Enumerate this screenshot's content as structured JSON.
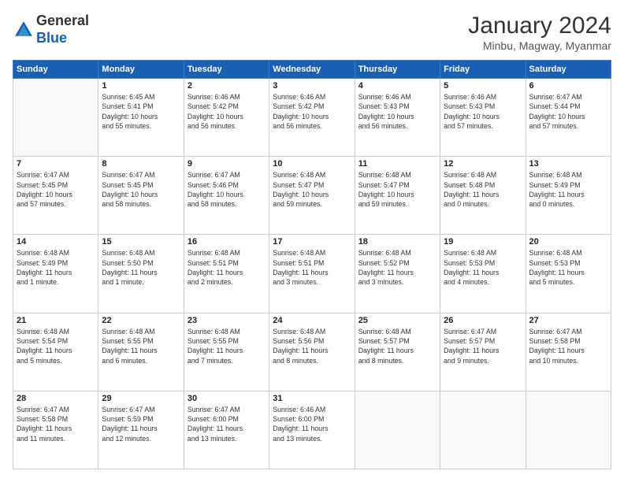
{
  "logo": {
    "line1": "General",
    "line2": "Blue"
  },
  "title": "January 2024",
  "location": "Minbu, Magway, Myanmar",
  "days_header": [
    "Sunday",
    "Monday",
    "Tuesday",
    "Wednesday",
    "Thursday",
    "Friday",
    "Saturday"
  ],
  "weeks": [
    [
      {
        "day": "",
        "info": ""
      },
      {
        "day": "1",
        "info": "Sunrise: 6:45 AM\nSunset: 5:41 PM\nDaylight: 10 hours\nand 55 minutes."
      },
      {
        "day": "2",
        "info": "Sunrise: 6:46 AM\nSunset: 5:42 PM\nDaylight: 10 hours\nand 56 minutes."
      },
      {
        "day": "3",
        "info": "Sunrise: 6:46 AM\nSunset: 5:42 PM\nDaylight: 10 hours\nand 56 minutes."
      },
      {
        "day": "4",
        "info": "Sunrise: 6:46 AM\nSunset: 5:43 PM\nDaylight: 10 hours\nand 56 minutes."
      },
      {
        "day": "5",
        "info": "Sunrise: 6:46 AM\nSunset: 5:43 PM\nDaylight: 10 hours\nand 57 minutes."
      },
      {
        "day": "6",
        "info": "Sunrise: 6:47 AM\nSunset: 5:44 PM\nDaylight: 10 hours\nand 57 minutes."
      }
    ],
    [
      {
        "day": "7",
        "info": "Sunrise: 6:47 AM\nSunset: 5:45 PM\nDaylight: 10 hours\nand 57 minutes."
      },
      {
        "day": "8",
        "info": "Sunrise: 6:47 AM\nSunset: 5:45 PM\nDaylight: 10 hours\nand 58 minutes."
      },
      {
        "day": "9",
        "info": "Sunrise: 6:47 AM\nSunset: 5:46 PM\nDaylight: 10 hours\nand 58 minutes."
      },
      {
        "day": "10",
        "info": "Sunrise: 6:48 AM\nSunset: 5:47 PM\nDaylight: 10 hours\nand 59 minutes."
      },
      {
        "day": "11",
        "info": "Sunrise: 6:48 AM\nSunset: 5:47 PM\nDaylight: 10 hours\nand 59 minutes."
      },
      {
        "day": "12",
        "info": "Sunrise: 6:48 AM\nSunset: 5:48 PM\nDaylight: 11 hours\nand 0 minutes."
      },
      {
        "day": "13",
        "info": "Sunrise: 6:48 AM\nSunset: 5:49 PM\nDaylight: 11 hours\nand 0 minutes."
      }
    ],
    [
      {
        "day": "14",
        "info": "Sunrise: 6:48 AM\nSunset: 5:49 PM\nDaylight: 11 hours\nand 1 minute."
      },
      {
        "day": "15",
        "info": "Sunrise: 6:48 AM\nSunset: 5:50 PM\nDaylight: 11 hours\nand 1 minute."
      },
      {
        "day": "16",
        "info": "Sunrise: 6:48 AM\nSunset: 5:51 PM\nDaylight: 11 hours\nand 2 minutes."
      },
      {
        "day": "17",
        "info": "Sunrise: 6:48 AM\nSunset: 5:51 PM\nDaylight: 11 hours\nand 3 minutes."
      },
      {
        "day": "18",
        "info": "Sunrise: 6:48 AM\nSunset: 5:52 PM\nDaylight: 11 hours\nand 3 minutes."
      },
      {
        "day": "19",
        "info": "Sunrise: 6:48 AM\nSunset: 5:53 PM\nDaylight: 11 hours\nand 4 minutes."
      },
      {
        "day": "20",
        "info": "Sunrise: 6:48 AM\nSunset: 5:53 PM\nDaylight: 11 hours\nand 5 minutes."
      }
    ],
    [
      {
        "day": "21",
        "info": "Sunrise: 6:48 AM\nSunset: 5:54 PM\nDaylight: 11 hours\nand 5 minutes."
      },
      {
        "day": "22",
        "info": "Sunrise: 6:48 AM\nSunset: 5:55 PM\nDaylight: 11 hours\nand 6 minutes."
      },
      {
        "day": "23",
        "info": "Sunrise: 6:48 AM\nSunset: 5:55 PM\nDaylight: 11 hours\nand 7 minutes."
      },
      {
        "day": "24",
        "info": "Sunrise: 6:48 AM\nSunset: 5:56 PM\nDaylight: 11 hours\nand 8 minutes."
      },
      {
        "day": "25",
        "info": "Sunrise: 6:48 AM\nSunset: 5:57 PM\nDaylight: 11 hours\nand 8 minutes."
      },
      {
        "day": "26",
        "info": "Sunrise: 6:47 AM\nSunset: 5:57 PM\nDaylight: 11 hours\nand 9 minutes."
      },
      {
        "day": "27",
        "info": "Sunrise: 6:47 AM\nSunset: 5:58 PM\nDaylight: 11 hours\nand 10 minutes."
      }
    ],
    [
      {
        "day": "28",
        "info": "Sunrise: 6:47 AM\nSunset: 5:58 PM\nDaylight: 11 hours\nand 11 minutes."
      },
      {
        "day": "29",
        "info": "Sunrise: 6:47 AM\nSunset: 5:59 PM\nDaylight: 11 hours\nand 12 minutes."
      },
      {
        "day": "30",
        "info": "Sunrise: 6:47 AM\nSunset: 6:00 PM\nDaylight: 11 hours\nand 13 minutes."
      },
      {
        "day": "31",
        "info": "Sunrise: 6:46 AM\nSunset: 6:00 PM\nDaylight: 11 hours\nand 13 minutes."
      },
      {
        "day": "",
        "info": ""
      },
      {
        "day": "",
        "info": ""
      },
      {
        "day": "",
        "info": ""
      }
    ]
  ]
}
